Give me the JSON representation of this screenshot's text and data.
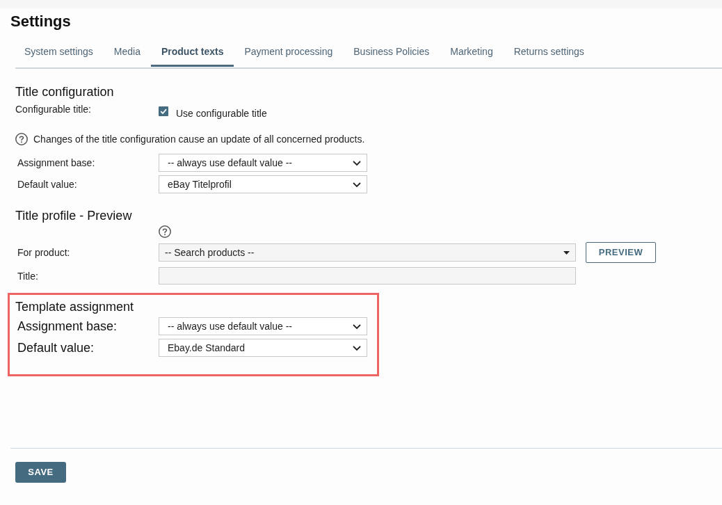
{
  "page": {
    "title": "Settings"
  },
  "tabs": [
    {
      "label": "System settings",
      "selected": false
    },
    {
      "label": "Media",
      "selected": false
    },
    {
      "label": "Product texts",
      "selected": true
    },
    {
      "label": "Payment processing",
      "selected": false
    },
    {
      "label": "Business Policies",
      "selected": false
    },
    {
      "label": "Marketing",
      "selected": false
    },
    {
      "label": "Returns settings",
      "selected": false
    }
  ],
  "title_configuration": {
    "heading": "Title configuration",
    "configurable_title": {
      "label": "Configurable title:",
      "checkbox_label": "Use configurable title",
      "checked": true
    },
    "help_text": "Changes of the title configuration cause an update of all concerned products.",
    "fields": [
      {
        "label": "Assignment base:",
        "value": "-- always use default value --"
      },
      {
        "label": "Default value:",
        "value": "eBay Titelprofil"
      }
    ]
  },
  "title_profile_preview": {
    "heading": "Title profile - Preview",
    "for_product": {
      "label": "For product:",
      "placeholder": "-- Search products --"
    },
    "preview_button": "PREVIEW",
    "title_field": {
      "label": "Title:"
    }
  },
  "template_assignment": {
    "heading": "Template assignment",
    "highlighted": true,
    "fields": [
      {
        "label": "Assignment base:",
        "value": "-- always use default value --"
      },
      {
        "label": "Default value:",
        "value": "Ebay.de Standard"
      }
    ]
  },
  "save_button": "SAVE"
}
